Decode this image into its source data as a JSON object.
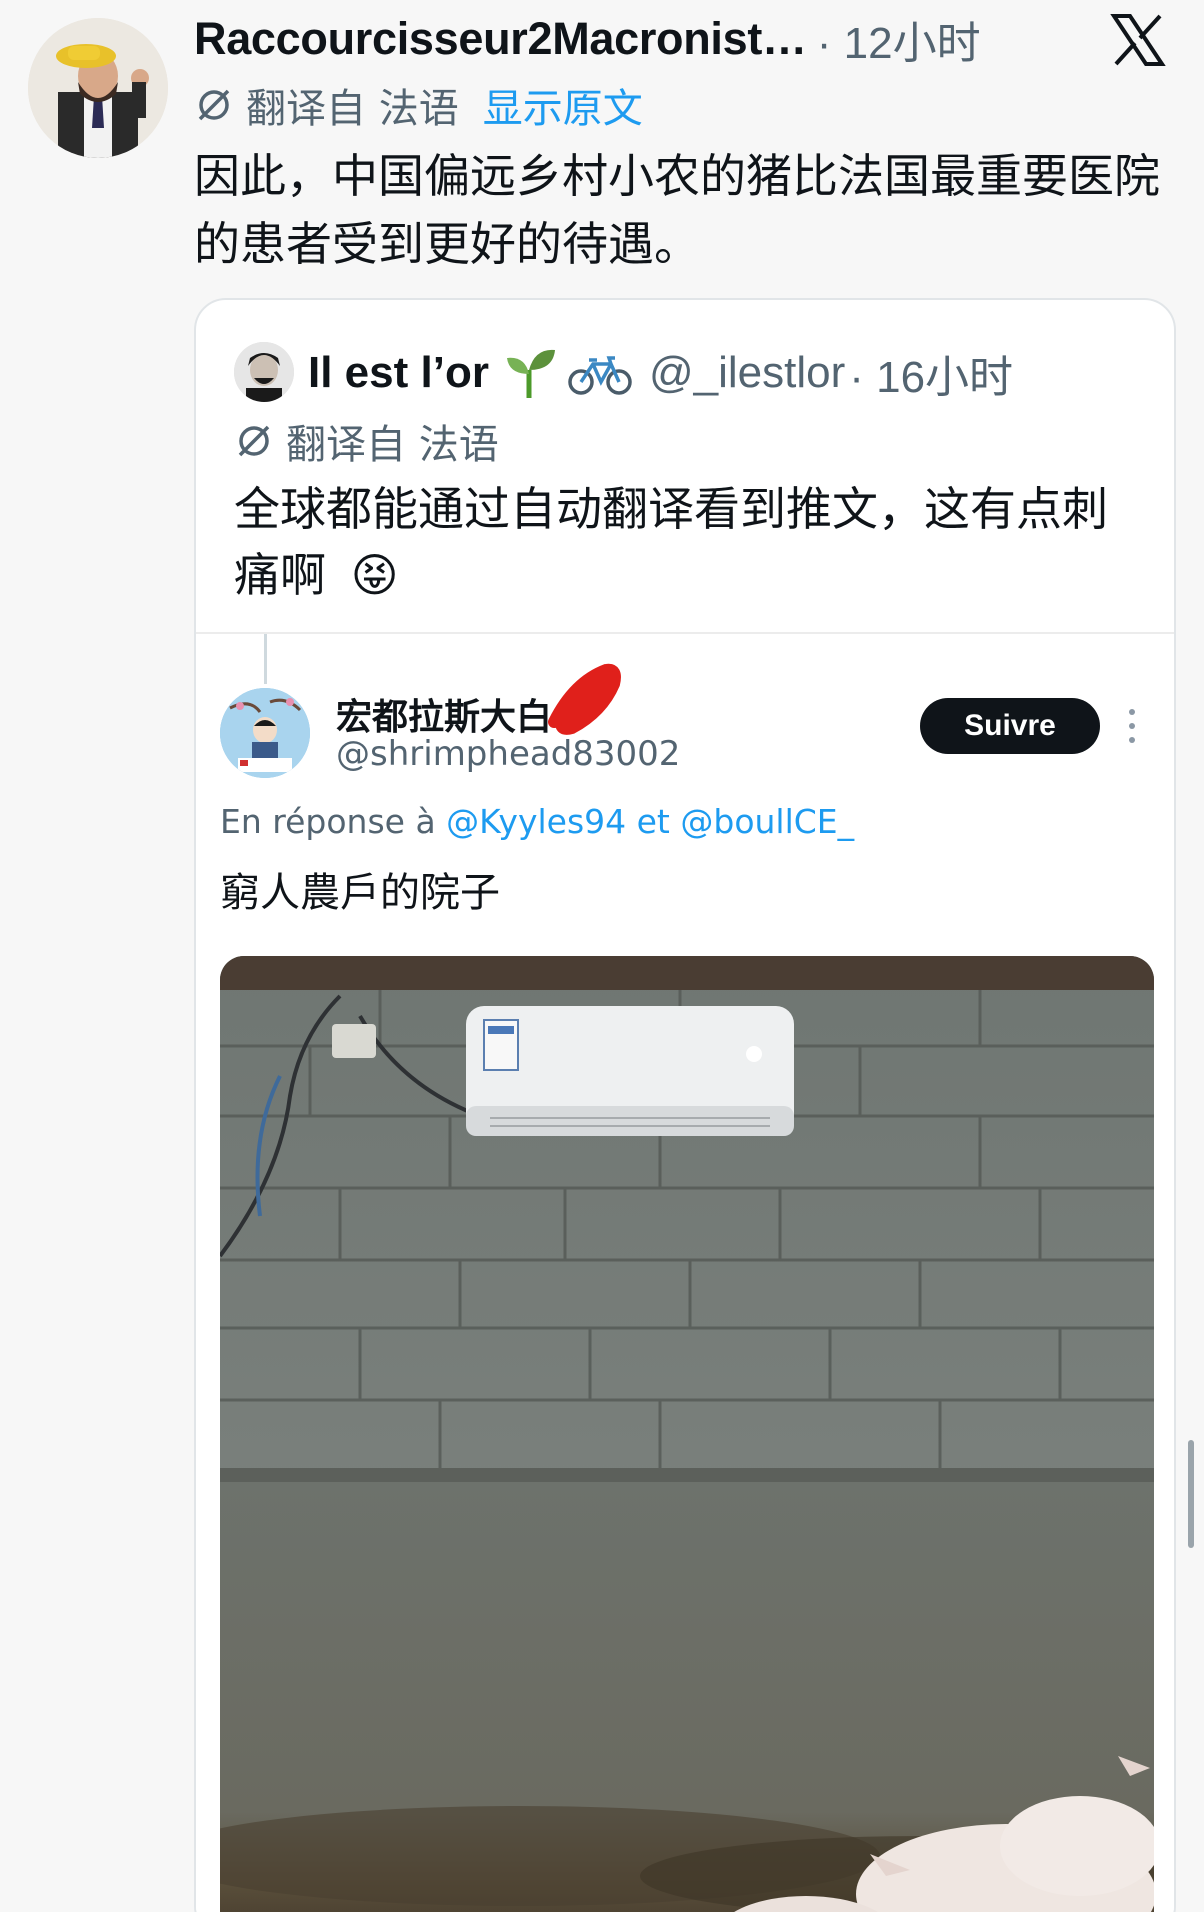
{
  "main_tweet": {
    "author_name": "Raccourcisseur2Macronist…",
    "time": "· 12小时",
    "translated_from": "翻译自 法语",
    "show_original": "显示原文",
    "text": "因此，中国偏远乡村小农的猪比法国最重要医院的患者受到更好的待遇。",
    "avatar_icon": "user-avatar-icon"
  },
  "quoted_tweet": {
    "author_name": "Il est l’or",
    "handle": "@_ilestlor",
    "time": "· 16小时",
    "translated_from": "翻译自 法语",
    "text": "全球都能通过自动翻译看到推文，这有点刺痛啊",
    "emoji": "😝",
    "name_icons": [
      "seedling-icon",
      "bicycle-icon"
    ]
  },
  "embedded_post": {
    "author_name": "宏都拉斯大白",
    "handle": "@shrimphead83002",
    "follow_label": "Suivre",
    "reply_prefix": "En réponse à",
    "reply_mention_1": "@Kyyles94",
    "reply_joiner": "et",
    "reply_mention_2": "@boullCE_",
    "text": "窮人農戶的院子",
    "photo_description_icon": "photo-icon"
  },
  "colors": {
    "accent": "#1d9bf0",
    "text_primary": "#0f1419",
    "text_secondary": "#536471",
    "follow_button_bg": "#0f1419",
    "scribble": "#e0201b"
  }
}
